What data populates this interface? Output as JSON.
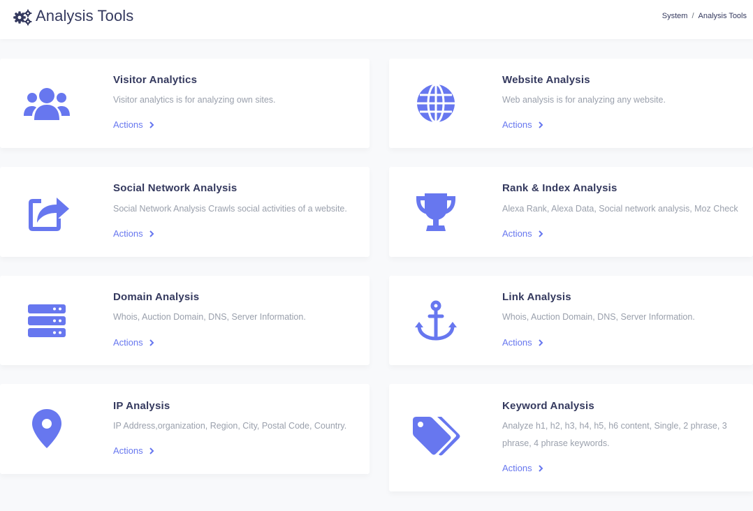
{
  "header": {
    "title": "Analysis Tools",
    "logo_icon": "cogs-icon",
    "breadcrumb": [
      "System",
      "Analysis Tools"
    ]
  },
  "accent_color": "#6777ef",
  "cards": [
    {
      "title": "Visitor Analytics",
      "description": "Visitor analytics is for analyzing own sites.",
      "action": "Actions",
      "icon": "users-icon"
    },
    {
      "title": "Website Analysis",
      "description": "Web analysis is for analyzing any website.",
      "action": "Actions",
      "icon": "globe-icon"
    },
    {
      "title": "Social Network Analysis",
      "description": "Social Network Analysis Crawls social activities of a website.",
      "action": "Actions",
      "icon": "share-square-icon"
    },
    {
      "title": "Rank & Index Analysis",
      "description": "Alexa Rank, Alexa Data, Social network analysis, Moz Check",
      "action": "Actions",
      "icon": "trophy-icon"
    },
    {
      "title": "Domain Analysis",
      "description": "Whois, Auction Domain, DNS, Server Information.",
      "action": "Actions",
      "icon": "server-icon"
    },
    {
      "title": "Link Analysis",
      "description": "Whois, Auction Domain, DNS, Server Information.",
      "action": "Actions",
      "icon": "anchor-icon"
    },
    {
      "title": "IP Analysis",
      "description": "IP Address,organization, Region, City, Postal Code, Country.",
      "action": "Actions",
      "icon": "map-marker-icon"
    },
    {
      "title": "Keyword Analysis",
      "description": "Analyze h1, h2, h3, h4, h5, h6 content, Single, 2 phrase, 3 phrase, 4 phrase keywords.",
      "action": "Actions",
      "icon": "tags-icon"
    }
  ]
}
